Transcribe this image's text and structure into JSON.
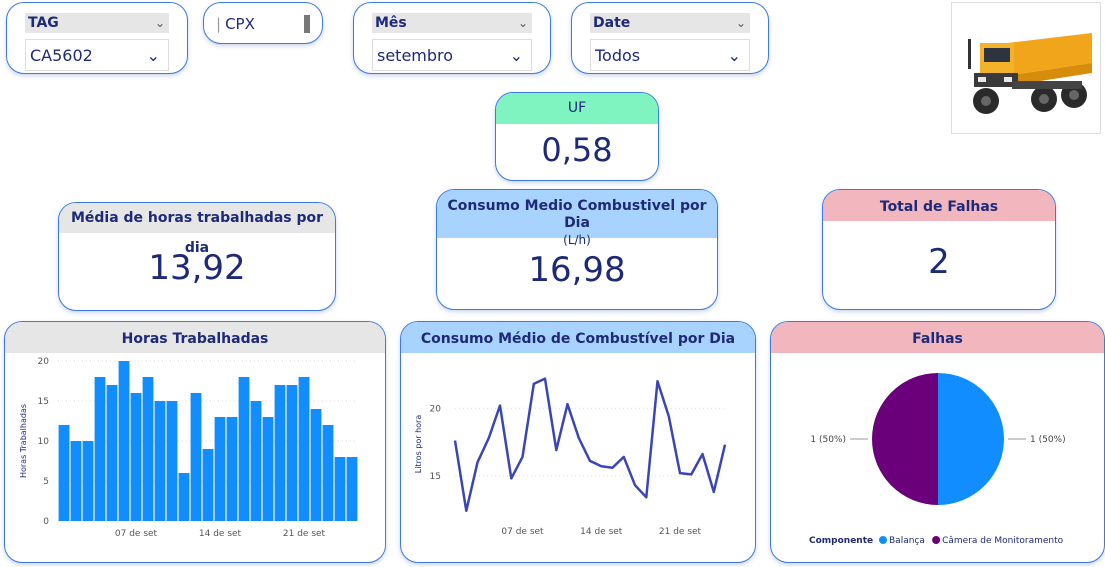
{
  "slicers": {
    "tag": {
      "title": "TAG",
      "value": "CA5602"
    },
    "cpx": {
      "value": "CPX"
    },
    "mes": {
      "title": "Mês",
      "value": "setembro"
    },
    "date": {
      "title": "Date",
      "value": "Todos"
    }
  },
  "kpis": {
    "uf": {
      "title": "UF",
      "value": "0,58"
    },
    "horas": {
      "title": "Média de horas trabalhadas por dia",
      "value": "13,92"
    },
    "consumo": {
      "title_line1": "Consumo Medio Combustivel por Dia",
      "title_line2": "(L/h)",
      "value": "16,98"
    },
    "falhas": {
      "title": "Total de Falhas",
      "value": "2"
    }
  },
  "colors": {
    "bar": "#118DFF",
    "line": "#3a46b5",
    "pie_balanca": "#118DFF",
    "pie_camera": "#6B007B",
    "head_green": "#7ff3c0",
    "head_blue": "#a9d3ff",
    "head_pink": "#f2b6be",
    "head_gray": "#e6e6e6"
  },
  "chart_data": [
    {
      "type": "bar",
      "title": "Horas Trabalhadas",
      "ylabel": "Horas Trabalhadas",
      "ylim": [
        0,
        20
      ],
      "yticks": [
        "0",
        "5",
        "10",
        "15",
        "20"
      ],
      "x_tick_labels": [
        "07 de set",
        "14 de set",
        "21 de set"
      ],
      "values": [
        12,
        10,
        10,
        18,
        17,
        20,
        16,
        18,
        15,
        15,
        6,
        16,
        9,
        13,
        13,
        18,
        15,
        13,
        17,
        17,
        18,
        14,
        12,
        8,
        8
      ],
      "grid": true
    },
    {
      "type": "line",
      "title": "Consumo Médio de Combustível por Dia",
      "ylabel": "Litros por hora",
      "ylim": [
        11.5,
        23.5
      ],
      "yticks": [
        "15",
        "20"
      ],
      "x_tick_labels": [
        "07 de set",
        "14 de set",
        "21 de set"
      ],
      "values": [
        17.6,
        12.4,
        16.0,
        17.8,
        20.2,
        14.8,
        16.4,
        21.8,
        22.2,
        16.9,
        20.3,
        17.8,
        16.1,
        15.7,
        15.6,
        16.4,
        14.3,
        13.4,
        22.0,
        19.4,
        15.2,
        15.1,
        16.6,
        13.8,
        17.3
      ],
      "grid": true
    },
    {
      "type": "pie",
      "title": "Falhas",
      "legend_title": "Componente",
      "slices": [
        {
          "label": "Balança",
          "value": 1,
          "data_label": "1 (50%)"
        },
        {
          "label": "Câmera de Monitoramento",
          "value": 1,
          "data_label": "1 (50%)"
        }
      ],
      "legend_position": "bottom"
    }
  ]
}
